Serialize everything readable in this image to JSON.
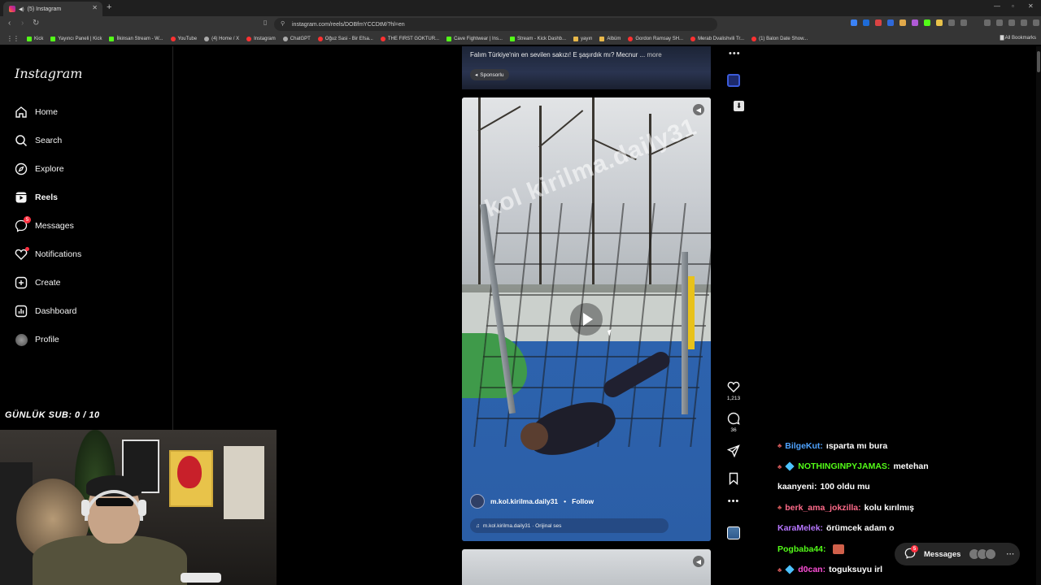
{
  "browser": {
    "tab_title": "(5) Instagram",
    "url": "instagram.com/reels/DOBfmYCCDtM/?hl=en",
    "bookmarks": [
      {
        "label": "Kick",
        "kind": "kick"
      },
      {
        "label": "Yayıncı Paneli | Kick",
        "kind": "kick"
      },
      {
        "label": "İlkinsan Stream - W...",
        "kind": "kick"
      },
      {
        "label": "YouTube",
        "kind": "yt"
      },
      {
        "label": "(4) Home / X",
        "kind": "x"
      },
      {
        "label": "Instagram",
        "kind": "ig"
      },
      {
        "label": "ChatGPT",
        "kind": "gpt"
      },
      {
        "label": "Oğuz Sasi - Bir Efsa...",
        "kind": "yt"
      },
      {
        "label": "THE FIRST GOKTUR...",
        "kind": "yt"
      },
      {
        "label": "Cave Fightwear | Ins...",
        "kind": "kick"
      },
      {
        "label": "Stream - Kick Dashb...",
        "kind": "kick"
      },
      {
        "label": "yayın",
        "kind": "folder"
      },
      {
        "label": "Albüm",
        "kind": "folder"
      },
      {
        "label": "Gordon Ramsay SH...",
        "kind": "yt"
      },
      {
        "label": "Merab Dvalishvili Tr...",
        "kind": "yt"
      },
      {
        "label": "(1) Balon Date Show...",
        "kind": "yt"
      }
    ],
    "all_bookmarks": "All Bookmarks"
  },
  "instagram": {
    "logo": "Instagram",
    "nav": [
      {
        "label": "Home",
        "icon": "home-icon"
      },
      {
        "label": "Search",
        "icon": "search-icon"
      },
      {
        "label": "Explore",
        "icon": "compass-icon"
      },
      {
        "label": "Reels",
        "icon": "reels-icon"
      },
      {
        "label": "Messages",
        "icon": "messenger-icon",
        "badge": "5"
      },
      {
        "label": "Notifications",
        "icon": "heart-icon"
      },
      {
        "label": "Create",
        "icon": "plus-square-icon"
      },
      {
        "label": "Dashboard",
        "icon": "chart-icon"
      },
      {
        "label": "Profile",
        "icon": "avatar"
      }
    ],
    "prev_post": {
      "caption": "Falım Türkiye'nin en sevilen sakızı! E şaşırdık mı? Mecnur ...",
      "more": "more",
      "sponsored": "Sponsorlu"
    },
    "reel": {
      "watermark": "kol kirilma.daily31",
      "author": "m.kol.kirilma.daily31",
      "separator": "•",
      "follow": "Follow",
      "audio": "m.kol.kirilma.daily31 · Orijinal ses",
      "likes": "1,213",
      "comments": "36"
    },
    "messages_pill": {
      "label": "Messages",
      "badge": "5",
      "more": "···"
    }
  },
  "stream_overlay": {
    "sub_counter": "GÜNLÜK SUB: 0 / 10",
    "chat": [
      {
        "user": "BilgeKut:",
        "color": "#4fa3ff",
        "message": "ısparta mı bura",
        "badges": [
          "icon"
        ]
      },
      {
        "user": "NOTHINGINPYJAMAS:",
        "color": "#53fc18",
        "message": "metehan",
        "badges": [
          "icon",
          "cube"
        ]
      },
      {
        "user": "kaanyeni:",
        "color": "#ffffff",
        "message": "100 oldu mu",
        "badges": []
      },
      {
        "user": "berk_ama_jokzilla:",
        "color": "#ff6b8a",
        "message": "kolu kırılmış",
        "badges": [
          "icon"
        ]
      },
      {
        "user": "KaraMelek:",
        "color": "#b776ff",
        "message": "örümcek adam o",
        "badges": []
      },
      {
        "user": "Pogbaba44:",
        "color": "#53fc18",
        "message": "",
        "badges": [
          "emote"
        ]
      },
      {
        "user": "d0can:",
        "color": "#ff4fd8",
        "message": "toguksuyu irl",
        "badges": [
          "icon",
          "cube"
        ]
      }
    ]
  }
}
